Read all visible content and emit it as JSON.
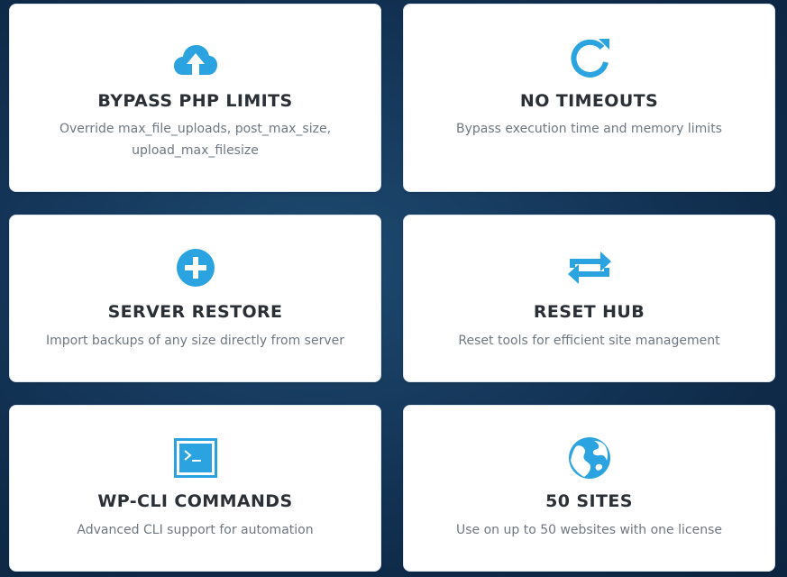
{
  "colors": {
    "accent": "#2aa3e0",
    "title": "#2b2f36",
    "description": "#6f7780",
    "card": "#ffffff",
    "background": "#163a5e"
  },
  "features": [
    {
      "icon": "cloud-upload-icon",
      "title": "BYPASS PHP LIMITS",
      "description": "Override max_file_uploads, post_max_size, upload_max_filesize"
    },
    {
      "icon": "refresh-icon",
      "title": "NO TIMEOUTS",
      "description": "Bypass execution time and memory limits"
    },
    {
      "icon": "plus-circle-icon",
      "title": "SERVER RESTORE",
      "description": "Import backups of any size directly from server"
    },
    {
      "icon": "repeat-arrows-icon",
      "title": "RESET HUB",
      "description": "Reset tools for efficient site management"
    },
    {
      "icon": "terminal-icon",
      "title": "WP-CLI COMMANDS",
      "description": "Advanced CLI support for automation"
    },
    {
      "icon": "globe-icon",
      "title": "50 SITES",
      "description": "Use on up to 50 websites with one license"
    }
  ]
}
